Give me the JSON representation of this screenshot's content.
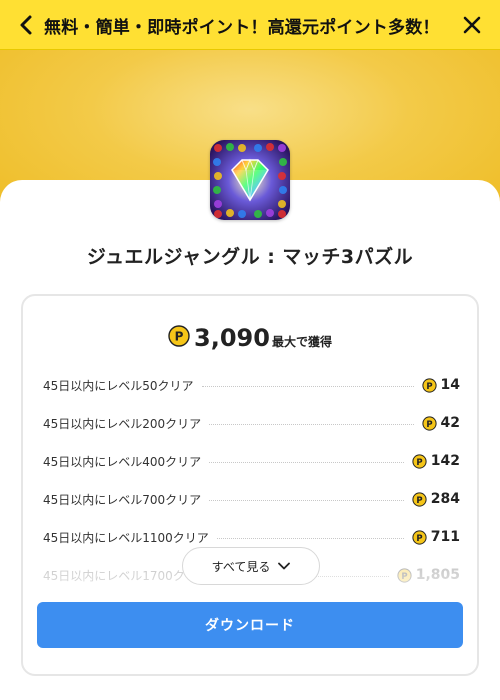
{
  "header": {
    "title": "無料・簡単・即時ポイント！高還元ポイント多数！"
  },
  "app": {
    "name": "ジュエルジャングル : マッチ3パズル"
  },
  "offer": {
    "total_points": "3,090",
    "total_suffix": "最大で獲得",
    "coin_symbol": "P",
    "tasks": [
      {
        "label": "45日以内にレベル50クリア",
        "points": "14"
      },
      {
        "label": "45日以内にレベル200クリア",
        "points": "42"
      },
      {
        "label": "45日以内にレベル400クリア",
        "points": "142"
      },
      {
        "label": "45日以内にレベル700クリア",
        "points": "284"
      },
      {
        "label": "45日以内にレベル1100クリア",
        "points": "711"
      },
      {
        "label": "45日以内にレベル1700ク",
        "points": "1,805"
      }
    ],
    "see_all_label": "すべて見る",
    "download_label": "ダウンロード"
  },
  "colors": {
    "header_bg": "#ffe033",
    "hero_bg": "#f3ca48",
    "primary_button": "#3d8ef0",
    "coin": "#f5c518"
  }
}
